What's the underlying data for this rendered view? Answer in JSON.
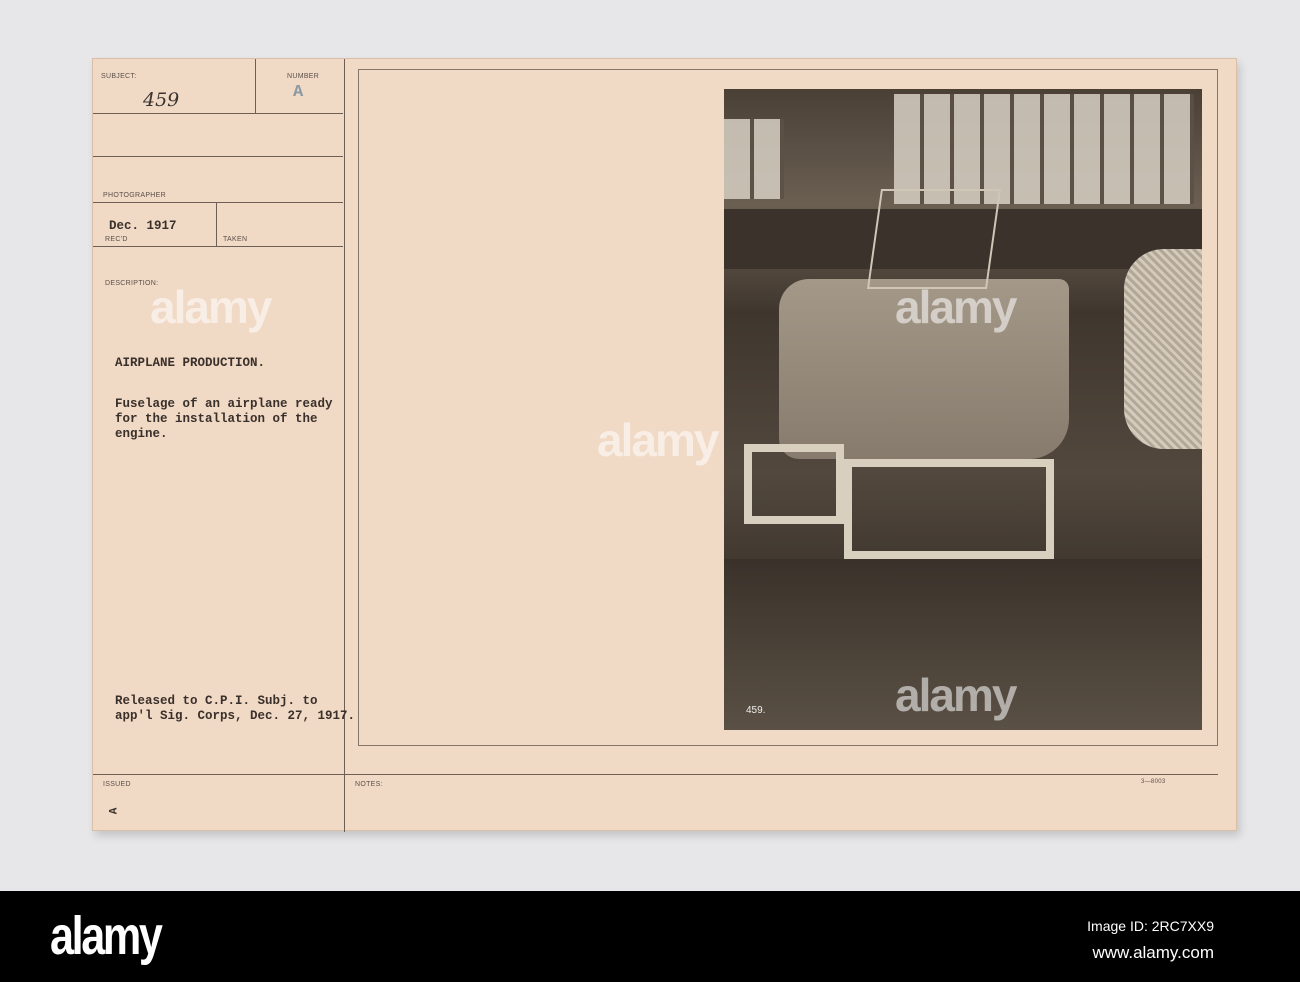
{
  "card": {
    "subject_label": "SUBJECT:",
    "subject_value": "459",
    "number_label": "NUMBER",
    "number_value": "A",
    "photographer_label": "PHOTOGRAPHER",
    "recd_value": "Dec. 1917",
    "recd_label": "REC'D",
    "taken_label": "TAKEN",
    "description_label": "DESCRIPTION:",
    "title": "AIRPLANE PRODUCTION.",
    "description": "Fuselage of an airplane ready\nfor the installation of the\nengine.",
    "release": "Released to C.P.I. Subj. to\napp'l Sig. Corps, Dec. 27, 1917.",
    "issued_label": "ISSUED",
    "notes_label": "NOTES:",
    "form_code": "3—8003",
    "corner_mark": "A",
    "photo_number": "459."
  },
  "watermark": "alamy",
  "banner": {
    "logo": "alamy",
    "image_id": "Image ID: 2RC7XX9",
    "url": "www.alamy.com"
  }
}
